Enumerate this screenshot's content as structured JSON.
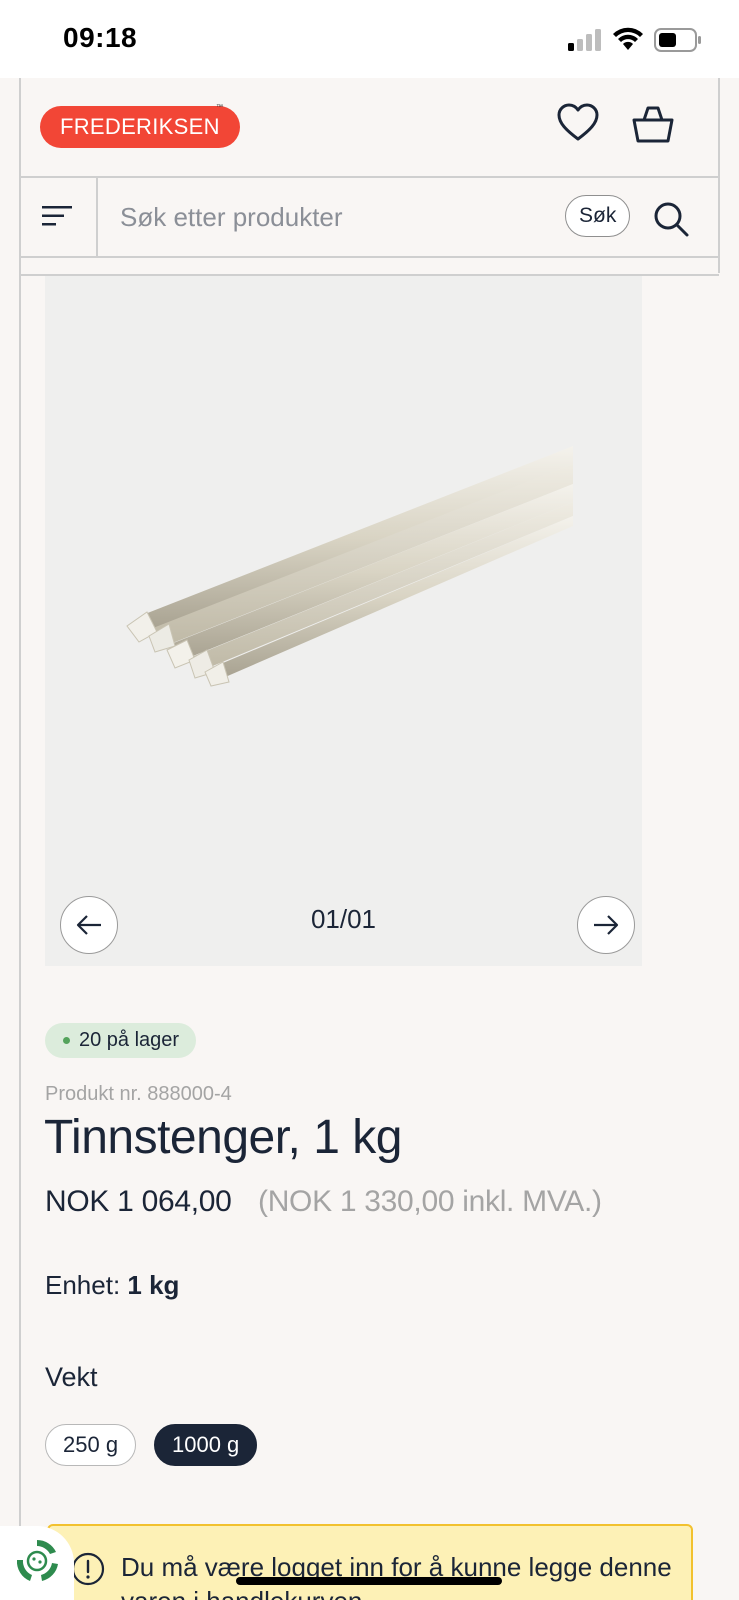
{
  "status_bar": {
    "time": "09:18"
  },
  "header": {
    "logo_text": "FREDERIKSEN",
    "logo_tm": "™",
    "icons": {
      "wishlist": "heart-icon",
      "cart": "basket-icon"
    }
  },
  "search": {
    "placeholder": "Søk etter produkter",
    "button_label": "Søk"
  },
  "gallery": {
    "counter": "01/01"
  },
  "product": {
    "stock_badge": "20 på lager",
    "sku": "Produkt nr. 888000-4",
    "title": "Tinnstenger, 1 kg",
    "price": "NOK 1 064,00",
    "price_incl_vat": "(NOK 1 330,00 inkl. MVA.)",
    "unit_label": "Enhet:",
    "unit_value": "1 kg",
    "variant_label": "Vekt",
    "variants": [
      {
        "label": "250 g",
        "selected": false
      },
      {
        "label": "1000 g",
        "selected": true
      }
    ]
  },
  "notice": {
    "text": "Du må være logget inn for å kunne legge denne varen i handlekurven"
  },
  "colors": {
    "brand": "#f24636",
    "text_primary": "#1b2537",
    "stock_bg": "#dcecdc",
    "notice_bg": "#fdf1b6",
    "notice_border": "#f2c12e"
  }
}
